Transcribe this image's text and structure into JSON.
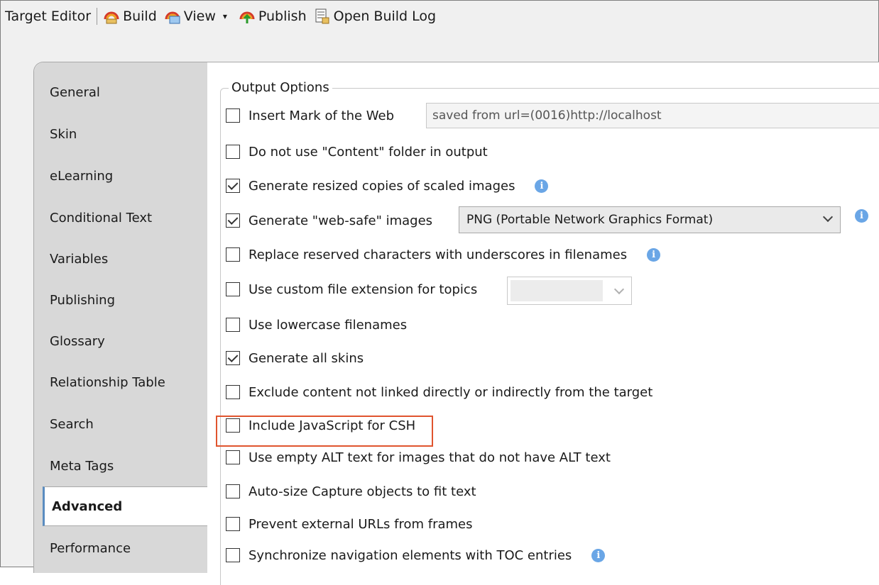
{
  "toolbar": {
    "title": "Target Editor",
    "build": "Build",
    "view": "View",
    "dropdown": "▾",
    "publish": "Publish",
    "log": "Open Build Log"
  },
  "tabs": [
    {
      "label": "General"
    },
    {
      "label": "Skin"
    },
    {
      "label": "eLearning"
    },
    {
      "label": "Conditional Text"
    },
    {
      "label": "Variables"
    },
    {
      "label": "Publishing"
    },
    {
      "label": "Glossary"
    },
    {
      "label": "Relationship Table"
    },
    {
      "label": "Search"
    },
    {
      "label": "Meta Tags"
    },
    {
      "label": "Advanced",
      "active": true
    },
    {
      "label": "Performance"
    }
  ],
  "group_title": "Output Options",
  "options": [
    {
      "label": "Insert Mark of the Web",
      "checked": false
    },
    {
      "label": "Do not use \"Content\" folder in output",
      "checked": false
    },
    {
      "label": "Generate resized copies of scaled images",
      "checked": true
    },
    {
      "label": "Generate \"web-safe\" images",
      "checked": true
    },
    {
      "label": "Replace reserved characters with underscores in filenames",
      "checked": false
    },
    {
      "label": "Use custom file extension for topics",
      "checked": false
    },
    {
      "label": "Use lowercase filenames",
      "checked": false
    },
    {
      "label": "Generate all skins",
      "checked": true
    },
    {
      "label": "Exclude content not linked directly or indirectly from the target",
      "checked": false
    },
    {
      "label": "Include JavaScript for CSH",
      "checked": false
    },
    {
      "label": "Use empty ALT text for images that do not have ALT text",
      "checked": false
    },
    {
      "label": "Auto-size Capture objects to fit text",
      "checked": false
    },
    {
      "label": "Prevent external URLs from frames",
      "checked": false
    },
    {
      "label": "Synchronize navigation elements with TOC entries",
      "checked": false
    }
  ],
  "mark_of_web_value": "saved from url=(0016)http://localhost",
  "websafe_format": "PNG (Portable Network Graphics Format)",
  "custom_extension_value": "",
  "info_glyph": "i",
  "colors": {
    "accent_highlight": "#e0542e",
    "info": "#6aa6e6",
    "active_tab_edge": "#5a8cc0"
  }
}
